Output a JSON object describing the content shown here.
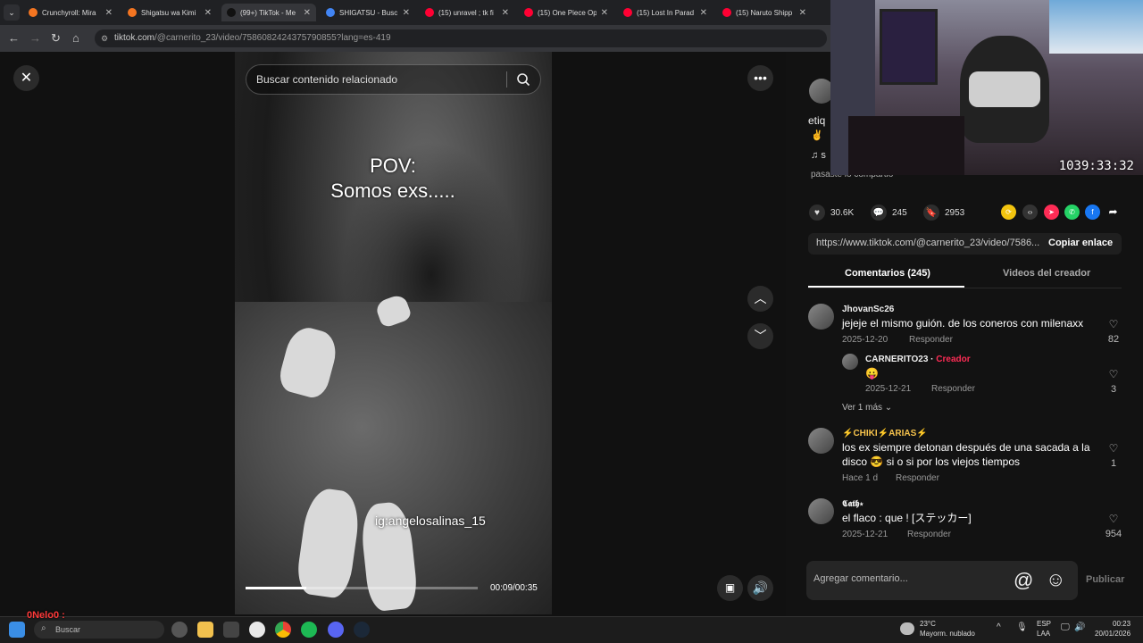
{
  "browser": {
    "tabs": [
      {
        "title": "Crunchyroll: Mira",
        "color": "#f47521"
      },
      {
        "title": "Shigatsu wa Kimi",
        "color": "#f47521"
      },
      {
        "title": "(99+) TikTok - Me",
        "color": "#111111"
      },
      {
        "title": "SHIGATSU - Busc",
        "color": "#4285f4"
      },
      {
        "title": "(15) unravel ; tk fi",
        "color": "#ff0033"
      },
      {
        "title": "(15) One Piece Op",
        "color": "#ff0033"
      },
      {
        "title": "(15) Lost In Parad",
        "color": "#ff0033"
      },
      {
        "title": "(15) Naruto Shipp",
        "color": "#ff0033"
      }
    ],
    "url_host": "tiktok.com",
    "url_path": "/@carnerito_23/video/7586082424375790855?lang=es-419"
  },
  "video": {
    "search_placeholder": "Buscar contenido relacionado",
    "caption": "POV:\nSomos exs.....",
    "watermark": "ig:angelosalinas_15",
    "time": "00:09/00:35",
    "progress": 0.26
  },
  "panel": {
    "author_fragment": "etiq",
    "music_fragment": "s",
    "shared_fragment": "pasaste lo compartió",
    "stats": {
      "likes": "30.6K",
      "comments": "245",
      "saves": "2953"
    },
    "share_url": "https://www.tiktok.com/@carnerito_23/video/7586...",
    "copy_label": "Copiar enlace",
    "tabs": {
      "comments": "Comentarios (245)",
      "creator_videos": "Videos del creador"
    },
    "comments": [
      {
        "user": "JhovanSc26",
        "text": "jejeje el mismo guión. de los coneros con milenaxx",
        "date": "2025-12-20",
        "reply": "Responder",
        "likes": "82"
      },
      {
        "user": "CARNERITO23",
        "badge": "Creador",
        "text": "😛",
        "date": "2025-12-21",
        "reply": "Responder",
        "likes": "3"
      },
      {
        "user": "⚡CHIKI⚡ARIAS⚡",
        "text": "los ex siempre detonan después de una sacada a la disco 😎 si o si por los viejos tiempos",
        "date": "Hace 1 d",
        "reply": "Responder",
        "likes": "1"
      },
      {
        "user": "𝕮𝖆𝖙𝖍⋆",
        "text": "el flaco : que ! [ステッカー]",
        "date": "2025-12-21",
        "reply": "Responder",
        "likes": "954"
      }
    ],
    "more_replies": "Ver 1 más",
    "comment_placeholder": "Agregar comentario...",
    "publish": "Publicar"
  },
  "webcam": {
    "timer": "1039:33:32"
  },
  "taskbar": {
    "stream_name": "0Nelo0 :",
    "search": "Buscar",
    "weather_temp": "23°C",
    "weather_desc": "Mayorm. nublado",
    "lang_top": "ESP",
    "lang_bottom": "LAA",
    "time": "00:23",
    "date": "20/01/2026"
  }
}
